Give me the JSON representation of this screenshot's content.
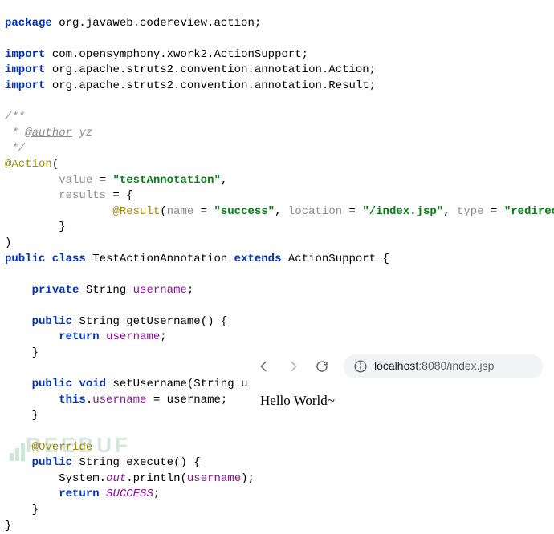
{
  "pkg_decl": {
    "kw": "package",
    "name": "org.javaweb.codereview.action;"
  },
  "imports": [
    {
      "kw": "import",
      "path": "com.opensymphony.xwork2.ActionSupport;"
    },
    {
      "kw": "import",
      "path": "org.apache.struts2.convention.annotation.",
      "cls": "Action",
      "suffix": ";"
    },
    {
      "kw": "import",
      "path": "org.apache.struts2.convention.annotation.",
      "cls": "Result",
      "suffix": ";"
    }
  ],
  "javadoc": {
    "open": "/**",
    "author_tag": "@author",
    "author_name": "yz",
    "close": " */"
  },
  "action_ann": {
    "at": "@Action",
    "open": "(",
    "value_key": "value",
    "value_val": "\"testAnnotation\"",
    "results_key": "results",
    "result_at": "@Result",
    "result_open": "(",
    "name_key": "name",
    "name_val": "\"success\"",
    "loc_key": "location",
    "loc_val": "\"/index.jsp\"",
    "type_key": "type",
    "type_val": "\"redirect\"",
    "result_close": ")",
    "close": ")"
  },
  "class_decl": {
    "mods": "public class",
    "name": "TestActionAnnotation",
    "ext": "extends",
    "sup": "ActionSupport"
  },
  "field": {
    "mods": "private",
    "type": "String",
    "name": "username"
  },
  "getter": {
    "mods": "public",
    "ret": "String",
    "name": "getUsername",
    "ret_kw": "return",
    "ret_expr": "username"
  },
  "setter": {
    "mods": "public",
    "ret": "void",
    "name": "setUsername",
    "ptype": "String",
    "pname": "username",
    "this": "this",
    "dot": ".",
    "lhs": "username",
    "rhs": "username"
  },
  "exec": {
    "override": "@Override",
    "mods": "public",
    "ret": "String",
    "name": "execute",
    "call_sys": "System",
    "call_out": "out",
    "call_m": "println",
    "arg": "username",
    "ret_kw": "return",
    "ret_val": "SUCCESS"
  },
  "browser": {
    "host": "localhost",
    "port": ":8080",
    "path": "/index.jsp",
    "body": "Hello World~"
  },
  "watermark": "REEBUF"
}
